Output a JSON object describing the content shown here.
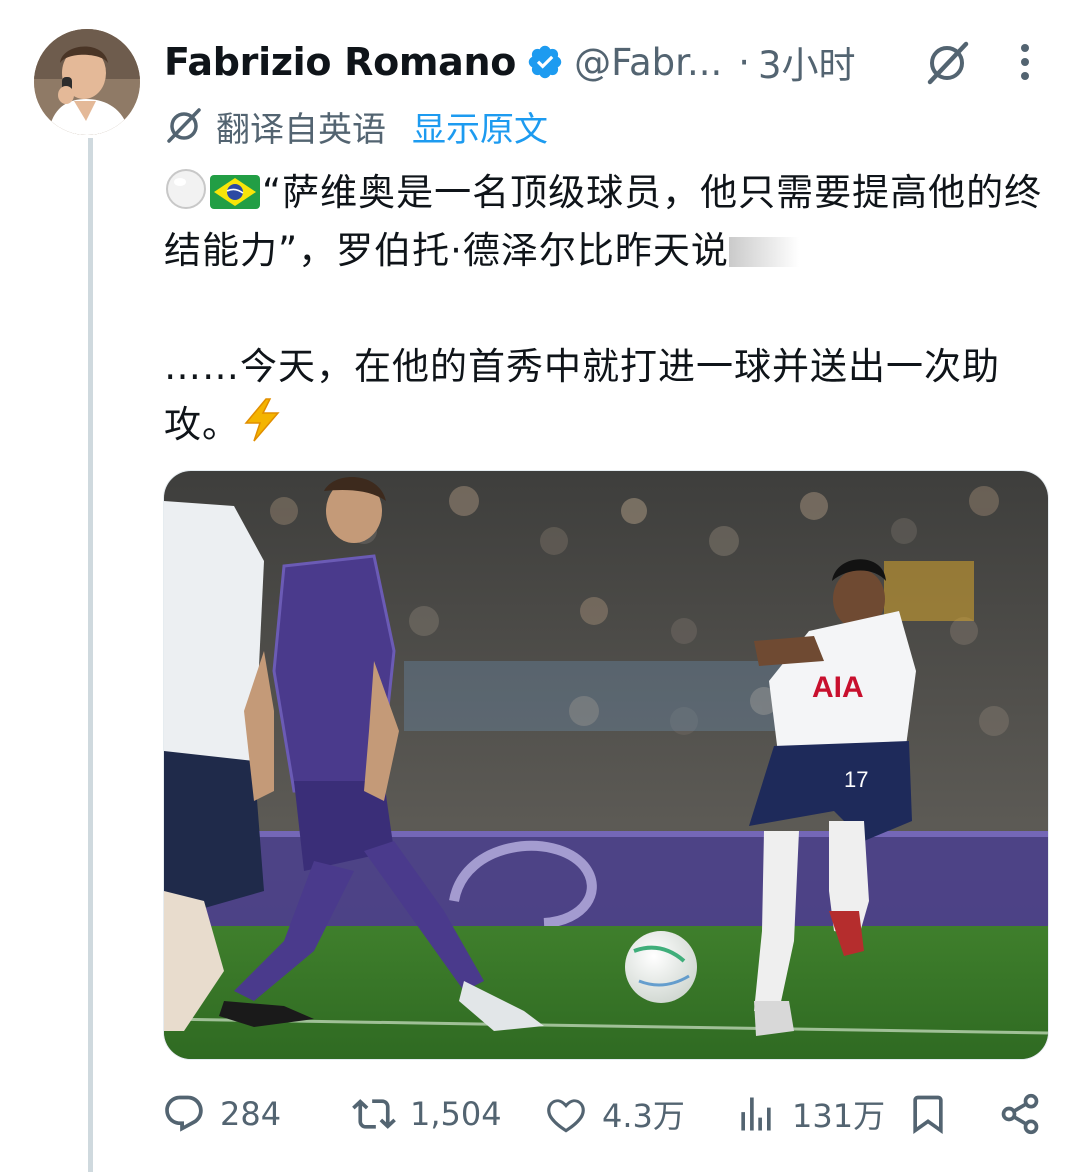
{
  "author": {
    "display_name": "Fabrizio Romano",
    "handle": "@Fabr...",
    "verified": true,
    "time_separator": "·",
    "time": "3小时"
  },
  "translation": {
    "label": "翻译自英语",
    "show_original": "显示原文"
  },
  "tweet": {
    "line1_text": "“萨维奥是一名顶级球员，他只需要提高他的终结能力”，罗伯托·德泽尔比昨天说",
    "line2_text": "……今天，在他的首秀中就打进一球并送出一次助攻。",
    "emojis": [
      "white-circle",
      "brazil-flag",
      "lightning"
    ]
  },
  "media": {
    "description_alt": "",
    "ad_text": "AIA",
    "shirt_number": "17"
  },
  "actions": {
    "reply_count": "284",
    "retweet_count": "1,504",
    "like_count": "4.3万",
    "views_count": "131万"
  },
  "colors": {
    "accent": "#1d9bf0",
    "secondary_text": "#536471",
    "thread_line": "#cfd9de"
  },
  "icons": [
    "verified-badge-icon",
    "grok-icon",
    "more-icon",
    "translate-icon",
    "reply-icon",
    "retweet-icon",
    "like-icon",
    "views-icon",
    "bookmark-icon",
    "share-icon"
  ]
}
